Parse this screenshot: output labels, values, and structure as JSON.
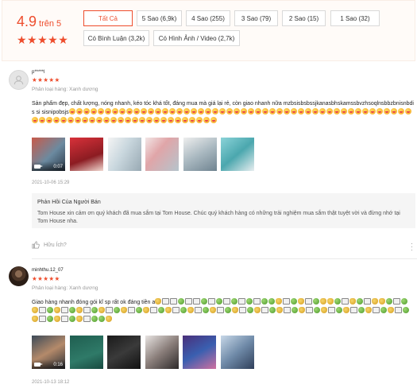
{
  "summary": {
    "score": "4.9",
    "out_of": "trên 5",
    "stars": "★★★★★",
    "filters": [
      {
        "label": "Tất Cả",
        "active": true
      },
      {
        "label": "5 Sao (6,9k)"
      },
      {
        "label": "4 Sao (255)"
      },
      {
        "label": "3 Sao (79)"
      },
      {
        "label": "2 Sao (15)"
      },
      {
        "label": "1 Sao (32)"
      },
      {
        "label": "Có Bình Luận (3,2k)"
      },
      {
        "label": "Có Hình Ảnh / Video (2,7k)"
      }
    ]
  },
  "reviews": [
    {
      "username": "p*****l",
      "stars": "★★★★★",
      "variant": "Phân loại hàng: Xanh dương",
      "text": "Sản phẩm đẹp, chất lượng, nóng nhanh, kéo tóc khá tốt, đáng mua mà giá lại rẻ, còn giao nhanh nữa mzbsisbsbssjkanasbhskamssbvzhsoqlnsbbzbnisnbdis si sisnipobsjs",
      "video_duration": "0:07",
      "date": "2021-10-06 15:29",
      "seller_reply": {
        "title": "Phản Hồi Của Người Bán",
        "text": "Tom House xin cảm ơn quý khách đã mua sắm tại Tom House. Chúc quý khách hàng có những trải nghiệm mua sắm thật tuyệt vời và đừng nhớ tại Tom House nha."
      },
      "helpful": "Hữu Ích?"
    },
    {
      "username": "minhthu.12_07",
      "stars": "★★★★★",
      "variant": "Phân loại hàng: Xanh dương",
      "text": "Giao hàng nhanh đóng gói kĩ sp rất ok đáng tiền a",
      "video_duration": "0:16",
      "date": "2021-10-13 18:12"
    }
  ],
  "colors": {
    "accent": "#ee4d2d",
    "muted": "#999999",
    "reply_bg": "#f5f5f5",
    "summary_bg": "#fffbf8"
  },
  "icons": {
    "avatar_default": "user-silhouette-icon",
    "video": "video-camera-icon",
    "helpful": "thumbs-up-icon",
    "more": "kebab-menu-icon"
  }
}
